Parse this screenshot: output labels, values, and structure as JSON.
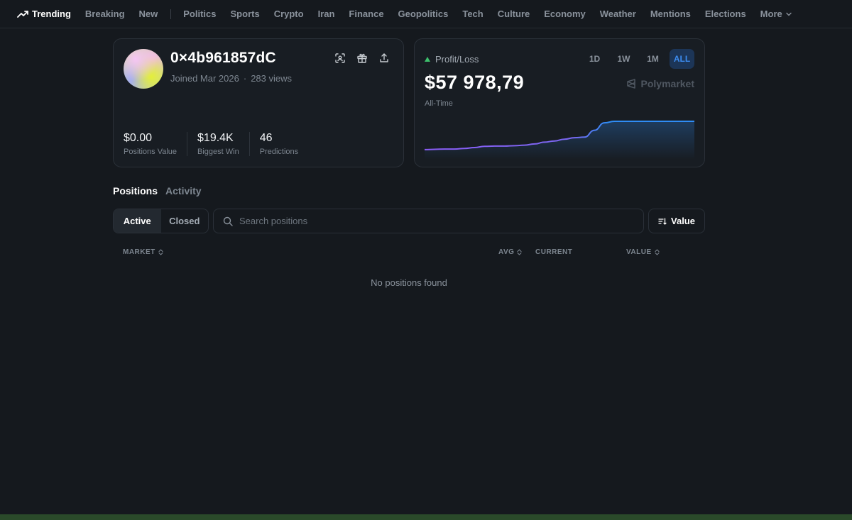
{
  "nav": {
    "items": [
      {
        "label": "Trending"
      },
      {
        "label": "Breaking"
      },
      {
        "label": "New"
      },
      {
        "label": "Politics"
      },
      {
        "label": "Sports"
      },
      {
        "label": "Crypto"
      },
      {
        "label": "Iran"
      },
      {
        "label": "Finance"
      },
      {
        "label": "Geopolitics"
      },
      {
        "label": "Tech"
      },
      {
        "label": "Culture"
      },
      {
        "label": "Economy"
      },
      {
        "label": "Weather"
      },
      {
        "label": "Mentions"
      },
      {
        "label": "Elections"
      }
    ],
    "more_label": "More",
    "active_item": "Trending"
  },
  "profile": {
    "username": "0×4b961857dC",
    "joined": "Joined Mar 2026",
    "separator": "·",
    "views": "283 views",
    "stats": [
      {
        "value": "$0.00",
        "label": "Positions Value"
      },
      {
        "value": "$19.4K",
        "label": "Biggest Win"
      },
      {
        "value": "46",
        "label": "Predictions"
      }
    ],
    "icons": [
      "scan-icon",
      "gift-icon",
      "share-icon"
    ]
  },
  "pnl": {
    "label": "Profit/Loss",
    "value": "$57 978,79",
    "period_label": "All-Time",
    "brand": "Polymarket",
    "ranges": [
      "1D",
      "1W",
      "1M",
      "ALL"
    ],
    "active_range": "ALL",
    "colors": {
      "up": "#3dc06c",
      "line_start": "#8b5cf6",
      "line_end": "#2f8cf5",
      "active_tab_bg": "#1c3557"
    }
  },
  "chart_data": {
    "type": "line",
    "series": [
      {
        "values": [
          0.05,
          0.06,
          0.07,
          0.07,
          0.09,
          0.12,
          0.16,
          0.17,
          0.17,
          0.18,
          0.2,
          0.24,
          0.3,
          0.34,
          0.4,
          0.45,
          0.47,
          0.7,
          0.95,
          1.0,
          1.0,
          1.0,
          1.0,
          1.0,
          1.0,
          1.0,
          1.0,
          1.0
        ]
      }
    ],
    "grid": false,
    "axes_visible": false
  },
  "tabs": {
    "items": [
      "Positions",
      "Activity"
    ],
    "active": "Positions"
  },
  "filters": {
    "segments": [
      "Active",
      "Closed"
    ],
    "active_segment": "Active",
    "search_placeholder": "Search positions",
    "search_value": "",
    "sort_label": "Value"
  },
  "table": {
    "columns": [
      "MARKET",
      "AVG",
      "CURRENT",
      "VALUE"
    ],
    "empty_message": "No positions found"
  }
}
